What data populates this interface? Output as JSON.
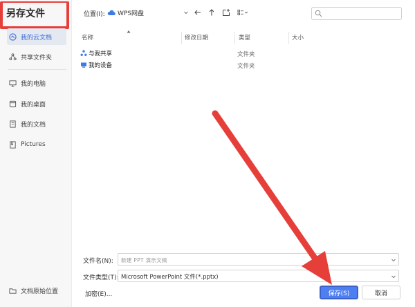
{
  "dialog": {
    "title": "另存文件"
  },
  "sidebar": {
    "items": [
      {
        "label": "我的云文档",
        "icon": "cloud-doc-icon",
        "active": true
      },
      {
        "label": "共享文件夹",
        "icon": "share-folder-icon"
      },
      {
        "label": "我的电脑",
        "icon": "computer-icon"
      },
      {
        "label": "我的桌面",
        "icon": "desktop-icon"
      },
      {
        "label": "我的文档",
        "icon": "document-icon"
      },
      {
        "label": "Pictures",
        "icon": "folder-icon"
      }
    ],
    "bottom_item": {
      "label": "文档原始位置",
      "icon": "folder-icon"
    }
  },
  "toolbar": {
    "location_label": "位置(I):",
    "location_value": "WPS网盘",
    "location_icon": "wps-cloud-icon"
  },
  "file_list": {
    "columns": [
      "名称",
      "修改日期",
      "类型",
      "大小"
    ],
    "rows": [
      {
        "name": "与我共享",
        "type": "文件夹",
        "icon": "shared-users-icon"
      },
      {
        "name": "我的设备",
        "type": "文件夹",
        "icon": "device-icon"
      }
    ]
  },
  "form": {
    "filename_label": "文件名(N):",
    "filename_value": "新建 PPT 演示文稿",
    "filetype_label": "文件类型(T):",
    "filetype_value": "Microsoft PowerPoint 文件(*.pptx)",
    "encrypt_label": "加密(E)...",
    "save_label": "保存(S)",
    "cancel_label": "取消"
  },
  "colors": {
    "accent": "#4d7ff2",
    "annotation_red": "#e63f3a"
  }
}
